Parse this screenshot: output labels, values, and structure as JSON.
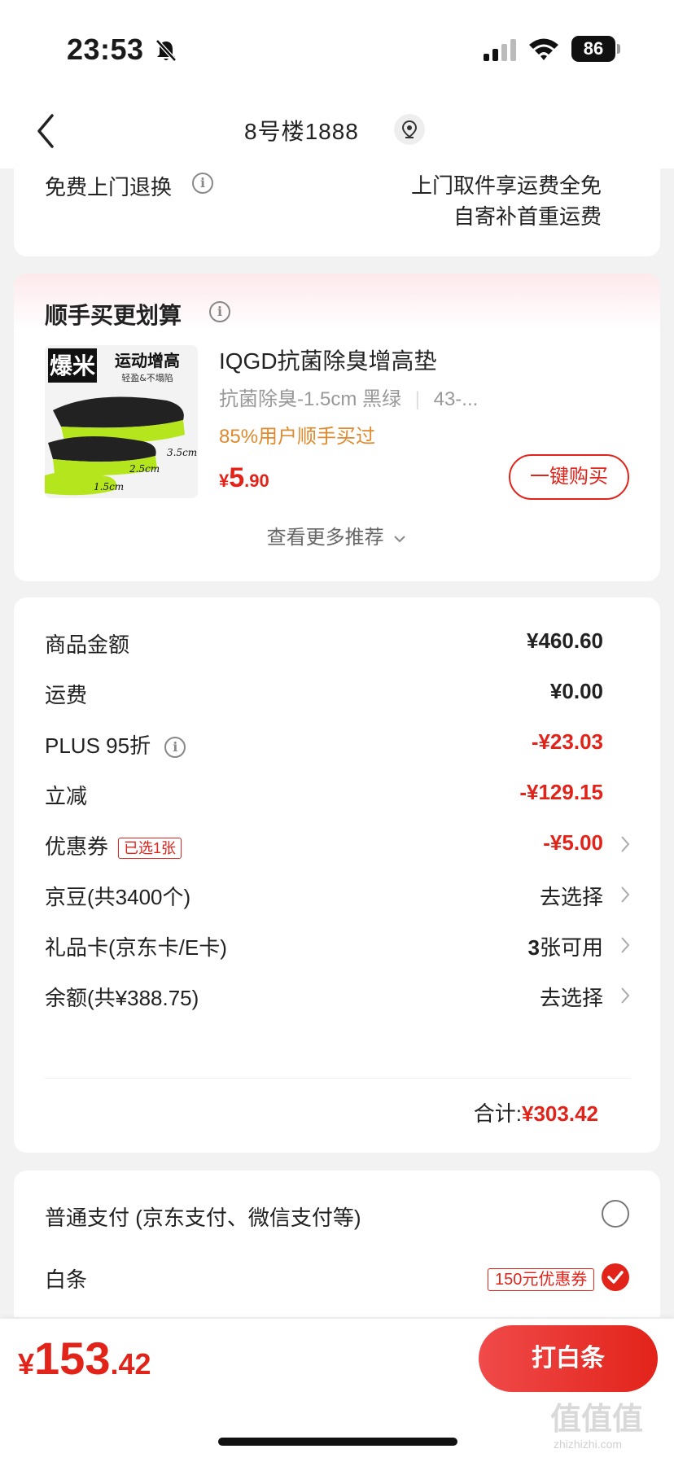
{
  "status": {
    "time": "23:53",
    "battery": "86"
  },
  "nav": {
    "title": "8号楼1888"
  },
  "return_service": {
    "label": "免费上门退换",
    "line1": "上门取件享运费全免",
    "line2": "自寄补首重运费"
  },
  "recommendation": {
    "title": "顺手买更划算",
    "product": {
      "name": "IQGD抗菌除臭增高垫",
      "spec": "抗菌除臭-1.5cm 黑绿",
      "size": "43-...",
      "bought": "85%用户顺手买过",
      "price_symbol": "¥",
      "price_int": "5",
      "price_dec": ".90",
      "image_text": {
        "badge": "爆米",
        "headline": "运动增高",
        "sub": "轻盈&不塌陷",
        "h1": "3.5cm",
        "h2": "2.5cm",
        "h3": "1.5cm"
      }
    },
    "buy_button": "一键购买",
    "more_link": "查看更多推荐"
  },
  "summary": {
    "rows": [
      {
        "label": "商品金额",
        "value": "¥460.60"
      },
      {
        "label": "运费",
        "value": "¥0.00"
      },
      {
        "label": "PLUS 95折",
        "value": "-¥23.03"
      },
      {
        "label": "立减",
        "value": "-¥129.15"
      },
      {
        "label": "优惠券",
        "tag": "已选1张",
        "value": "-¥5.00"
      },
      {
        "label": "京豆(共3400个)",
        "value": "去选择"
      },
      {
        "label": "礼品卡(京东卡/E卡)",
        "value_num": "3",
        "value_suffix": "张可用"
      },
      {
        "label": "余额(共¥388.75)",
        "value": "去选择"
      }
    ],
    "total_label": "合计:",
    "total_value": "¥303.42"
  },
  "payment": {
    "option1": "普通支付 (京东支付、微信支付等)",
    "option2": "白条",
    "option2_tag": "150元优惠券"
  },
  "bottom": {
    "price_symbol": "¥",
    "price_int": "153",
    "price_dec": ".42",
    "pay_button": "打白条"
  },
  "watermark": {
    "main": "值值值",
    "sub": "zhizhizhi.com"
  },
  "colors": {
    "accent": "#e2231a",
    "orange": "#e08a2e"
  }
}
